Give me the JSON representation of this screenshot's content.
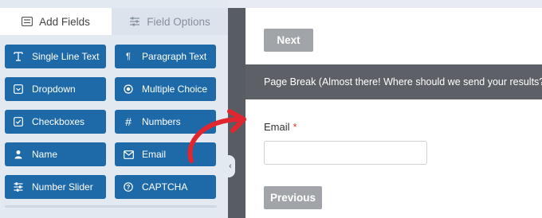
{
  "tabs": [
    {
      "label": "Add Fields",
      "icon": "list-icon",
      "active": true
    },
    {
      "label": "Field Options",
      "icon": "sliders-icon",
      "active": false
    }
  ],
  "fields": [
    {
      "label": "Single Line Text",
      "icon": "text-cursor-icon"
    },
    {
      "label": "Paragraph Text",
      "icon": "paragraph-icon"
    },
    {
      "label": "Dropdown",
      "icon": "dropdown-icon"
    },
    {
      "label": "Multiple Choice",
      "icon": "radio-icon"
    },
    {
      "label": "Checkboxes",
      "icon": "checkbox-icon"
    },
    {
      "label": "Numbers",
      "icon": "hash-icon"
    },
    {
      "label": "Name",
      "icon": "user-icon"
    },
    {
      "label": "Email",
      "icon": "envelope-icon"
    },
    {
      "label": "Number Slider",
      "icon": "sliders-icon"
    },
    {
      "label": "CAPTCHA",
      "icon": "question-icon"
    }
  ],
  "preview": {
    "next_label": "Next",
    "page_break_text": "Page Break (Almost there! Where should we send your results?)",
    "email_label": "Email",
    "required_mark": "*",
    "previous_label": "Previous"
  },
  "colors": {
    "button_blue": "#1e6aa8",
    "divider_dark": "#585d64",
    "arrow_red": "#e0262e",
    "required_red": "#d63638"
  }
}
